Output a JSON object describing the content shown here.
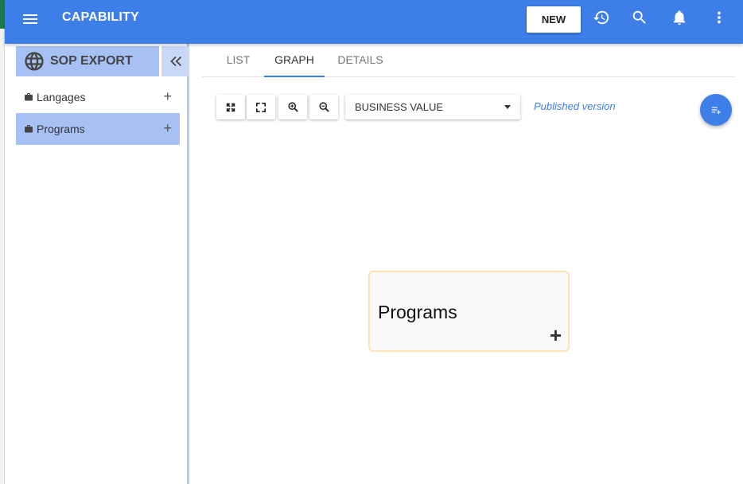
{
  "app": {
    "title": "CAPABILITY",
    "new_label": "NEW"
  },
  "sidebar": {
    "header": "SOP EXPORT",
    "items": [
      {
        "label": "Langages",
        "active": false
      },
      {
        "label": "Programs",
        "active": true
      }
    ]
  },
  "tabs": [
    {
      "label": "LIST",
      "active": false
    },
    {
      "label": "GRAPH",
      "active": true
    },
    {
      "label": "DETAILS",
      "active": false
    }
  ],
  "toolbar": {
    "view_select": {
      "selected": "BUSINESS VALUE"
    },
    "published": "Published version"
  },
  "graph": {
    "nodes": [
      {
        "label": "Programs"
      }
    ]
  },
  "colors": {
    "primary": "#3e7ee8",
    "sidebar_active": "#a8c1f4",
    "node_border": "#fde3b5"
  },
  "icons": {
    "appbar": [
      "menu-icon",
      "history-icon",
      "search-icon",
      "bell-icon",
      "more-vert-icon"
    ],
    "toolbar": [
      "fit-view-icon",
      "fullscreen-icon",
      "zoom-in-icon",
      "zoom-out-icon"
    ],
    "fab": "add-list-icon"
  }
}
